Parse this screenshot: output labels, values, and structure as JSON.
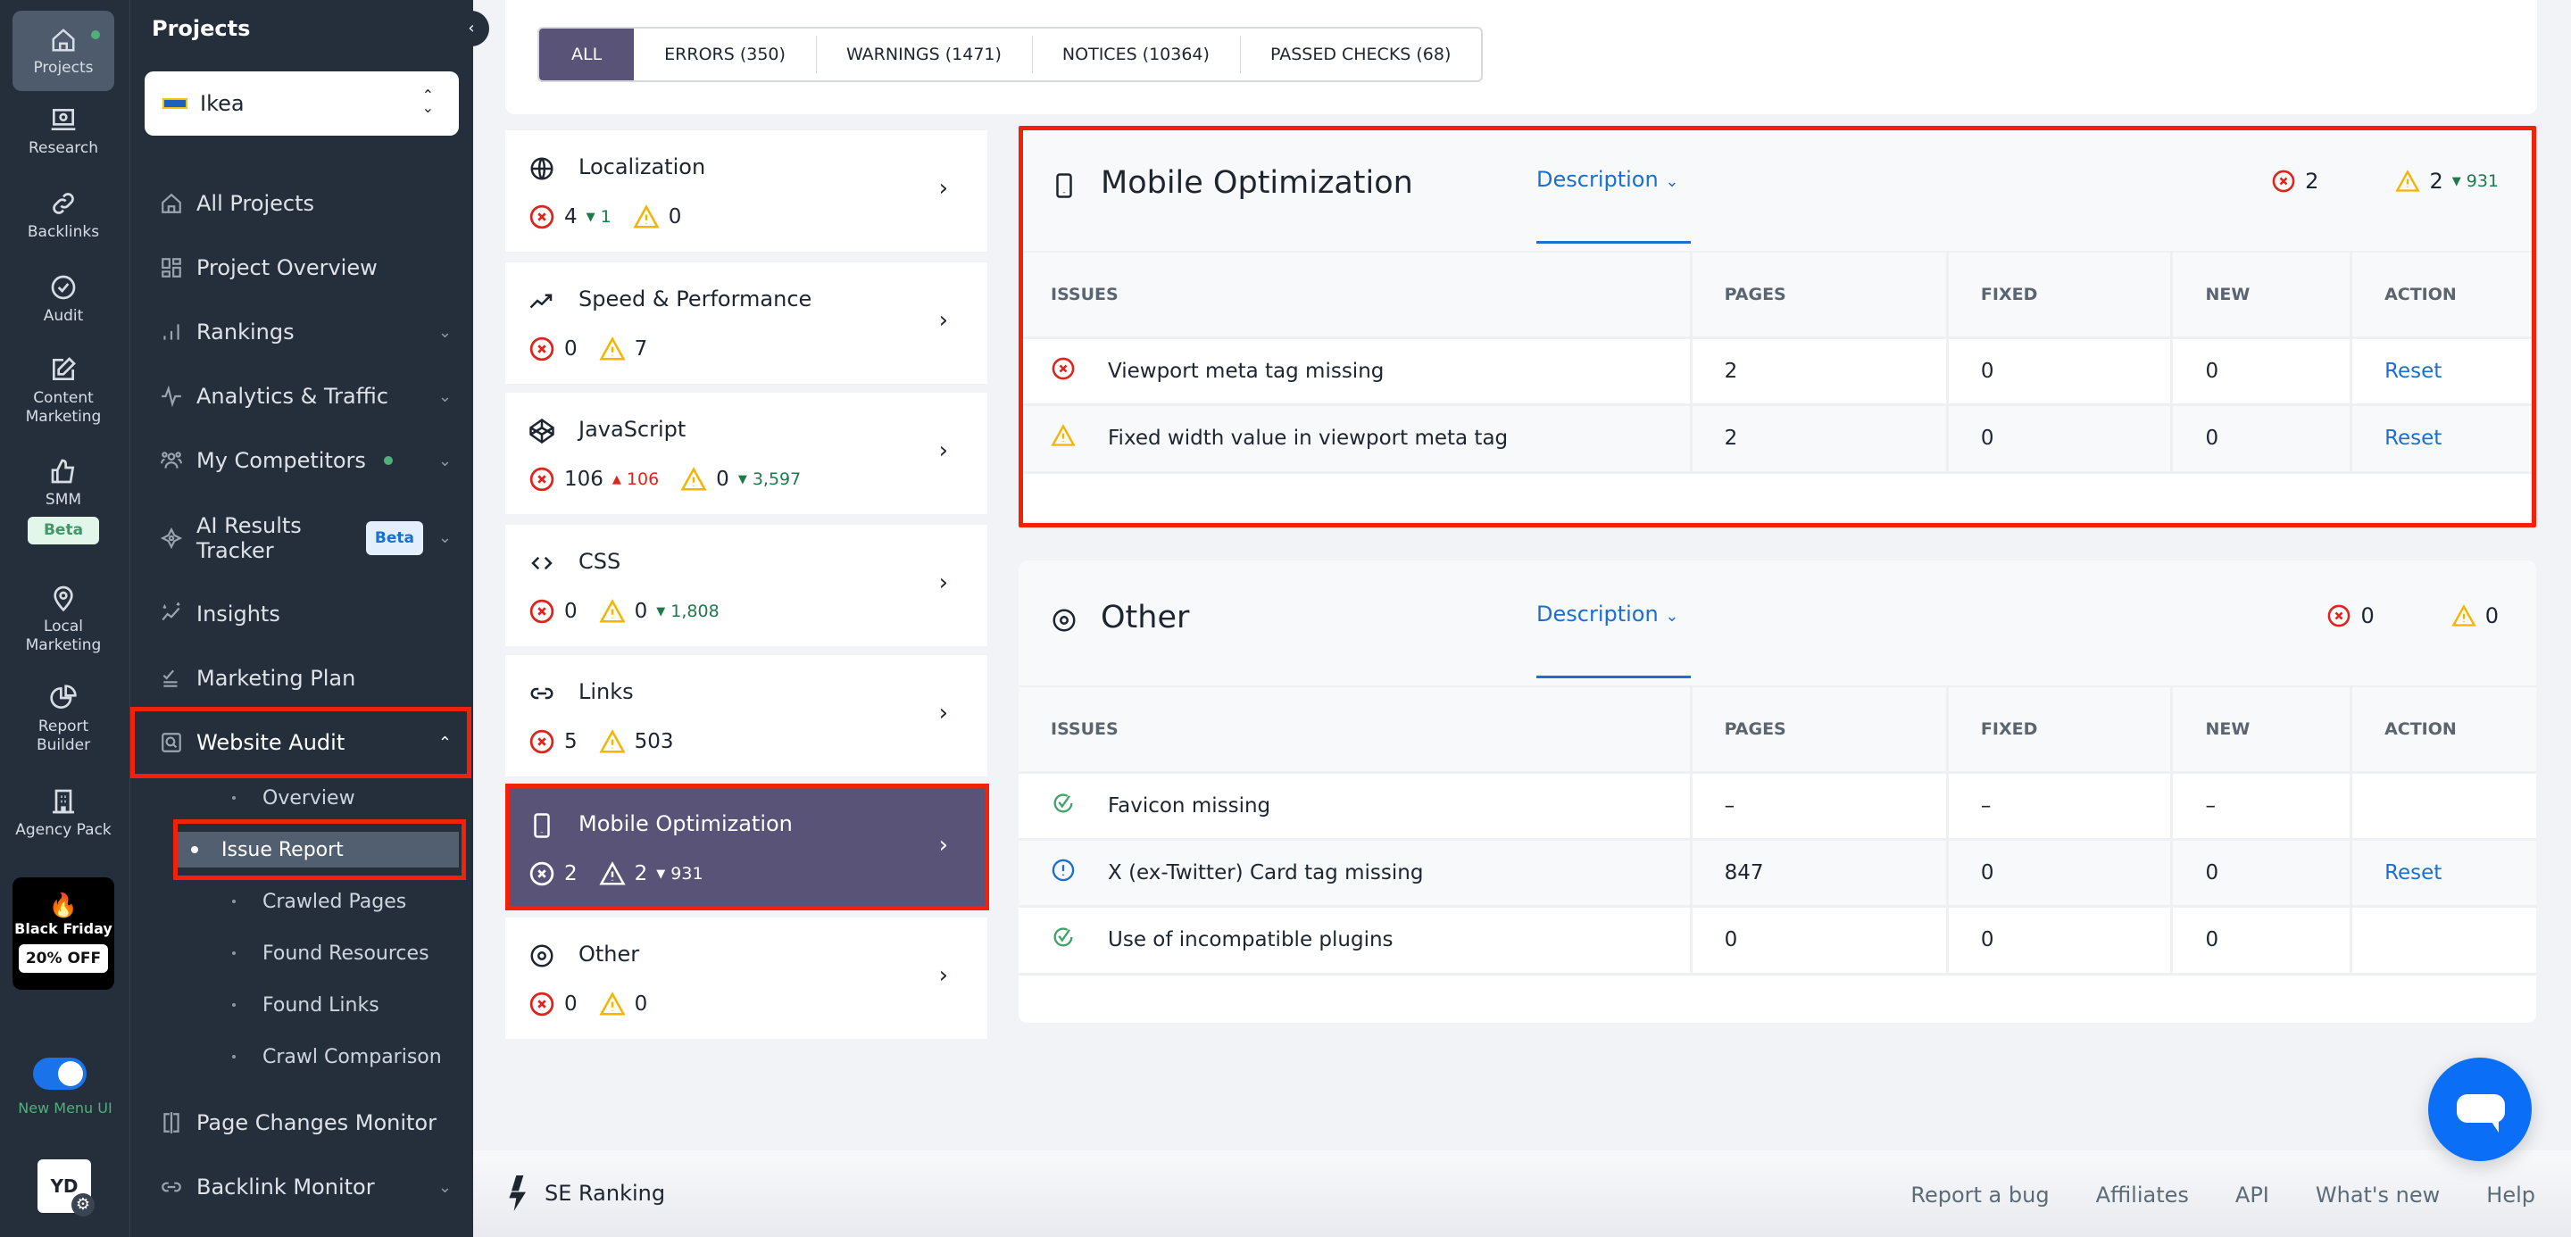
{
  "rail": {
    "items": [
      {
        "label": "Projects",
        "icon": "home-icon"
      },
      {
        "label": "Research",
        "icon": "laptop-search-icon"
      },
      {
        "label": "Backlinks",
        "icon": "link-icon"
      },
      {
        "label": "Audit",
        "icon": "check-circle-icon"
      },
      {
        "label": "Content Marketing",
        "icon": "edit-icon"
      },
      {
        "label": "SMM",
        "icon": "thumbs-up-icon",
        "badge": "Beta"
      },
      {
        "label": "Local Marketing",
        "icon": "map-pin-icon"
      },
      {
        "label": "Report Builder",
        "icon": "pie-chart-icon"
      },
      {
        "label": "Agency Pack",
        "icon": "building-icon"
      }
    ],
    "promo": {
      "title": "Black Friday",
      "offer": "20% OFF"
    },
    "toggle_label": "New Menu UI",
    "toggle_on": true,
    "avatar_initials": "YD"
  },
  "nav": {
    "title": "Projects",
    "project": "Ikea",
    "items": [
      {
        "label": "All Projects"
      },
      {
        "label": "Project Overview"
      },
      {
        "label": "Rankings"
      },
      {
        "label": "Analytics & Traffic"
      },
      {
        "label": "My Competitors"
      },
      {
        "label": "AI Results Tracker",
        "badge": "Beta"
      },
      {
        "label": "Insights"
      },
      {
        "label": "Marketing Plan"
      },
      {
        "label": "Website Audit"
      },
      {
        "label": "Page Changes Monitor"
      },
      {
        "label": "Backlink Monitor"
      }
    ],
    "audit_sub": [
      "Overview",
      "Issue Report",
      "Crawled Pages",
      "Found Resources",
      "Found Links",
      "Crawl Comparison"
    ],
    "active_sub": "Issue Report"
  },
  "tabs": [
    {
      "label": "ALL",
      "active": true
    },
    {
      "label": "ERRORS (350)"
    },
    {
      "label": "WARNINGS (1471)"
    },
    {
      "label": "NOTICES (10364)"
    },
    {
      "label": "PASSED CHECKS (68)"
    }
  ],
  "categories": [
    {
      "name": "Localization",
      "errors": "4",
      "err_delta": "1",
      "err_delta_dir": "down",
      "warnings": "0",
      "warn_delta": "",
      "warn_delta_dir": ""
    },
    {
      "name": "Speed & Performance",
      "errors": "0",
      "err_delta": "",
      "err_delta_dir": "",
      "warnings": "7",
      "warn_delta": "",
      "warn_delta_dir": ""
    },
    {
      "name": "JavaScript",
      "errors": "106",
      "err_delta": "106",
      "err_delta_dir": "up",
      "warnings": "0",
      "warn_delta": "3,597",
      "warn_delta_dir": "down"
    },
    {
      "name": "CSS",
      "errors": "0",
      "err_delta": "",
      "err_delta_dir": "",
      "warnings": "0",
      "warn_delta": "1,808",
      "warn_delta_dir": "down"
    },
    {
      "name": "Links",
      "errors": "5",
      "err_delta": "",
      "err_delta_dir": "",
      "warnings": "503",
      "warn_delta": "",
      "warn_delta_dir": ""
    },
    {
      "name": "Mobile Optimization",
      "errors": "2",
      "err_delta": "",
      "err_delta_dir": "",
      "warnings": "2",
      "warn_delta": "931",
      "warn_delta_dir": "down",
      "selected": true
    },
    {
      "name": "Other",
      "errors": "0",
      "err_delta": "",
      "err_delta_dir": "",
      "warnings": "0",
      "warn_delta": "",
      "warn_delta_dir": ""
    }
  ],
  "panels": [
    {
      "title": "Mobile Optimization",
      "description_label": "Description",
      "errors": "2",
      "warnings": "2",
      "warn_delta": "931",
      "columns": [
        "ISSUES",
        "PAGES",
        "FIXED",
        "NEW",
        "ACTION"
      ],
      "rows": [
        {
          "status": "error",
          "issue": "Viewport meta tag missing",
          "pages": "2",
          "fixed": "0",
          "new": "0",
          "action": "Reset"
        },
        {
          "status": "warning",
          "issue": "Fixed width value in viewport meta tag",
          "pages": "2",
          "fixed": "0",
          "new": "0",
          "action": "Reset"
        }
      ]
    },
    {
      "title": "Other",
      "description_label": "Description",
      "errors": "0",
      "warnings": "0",
      "warn_delta": "",
      "columns": [
        "ISSUES",
        "PAGES",
        "FIXED",
        "NEW",
        "ACTION"
      ],
      "rows": [
        {
          "status": "passed",
          "issue": "Favicon missing",
          "pages": "–",
          "fixed": "–",
          "new": "–",
          "action": ""
        },
        {
          "status": "notice",
          "issue": "X (ex-Twitter) Card tag missing",
          "pages": "847",
          "fixed": "0",
          "new": "0",
          "action": "Reset"
        },
        {
          "status": "passed",
          "issue": "Use of incompatible plugins",
          "pages": "0",
          "fixed": "0",
          "new": "0",
          "action": ""
        }
      ]
    }
  ],
  "footer": {
    "brand": "SE Ranking",
    "links": [
      "Report a bug",
      "Affiliates",
      "API",
      "What's new",
      "Help"
    ]
  },
  "colors": {
    "accent": "#5a5378",
    "link": "#1a6fd1",
    "error": "#e0241b",
    "warning": "#f5b400",
    "positive": "#1f7a4a",
    "highlight": "#f4210a",
    "sidebar": "#252f3c"
  }
}
